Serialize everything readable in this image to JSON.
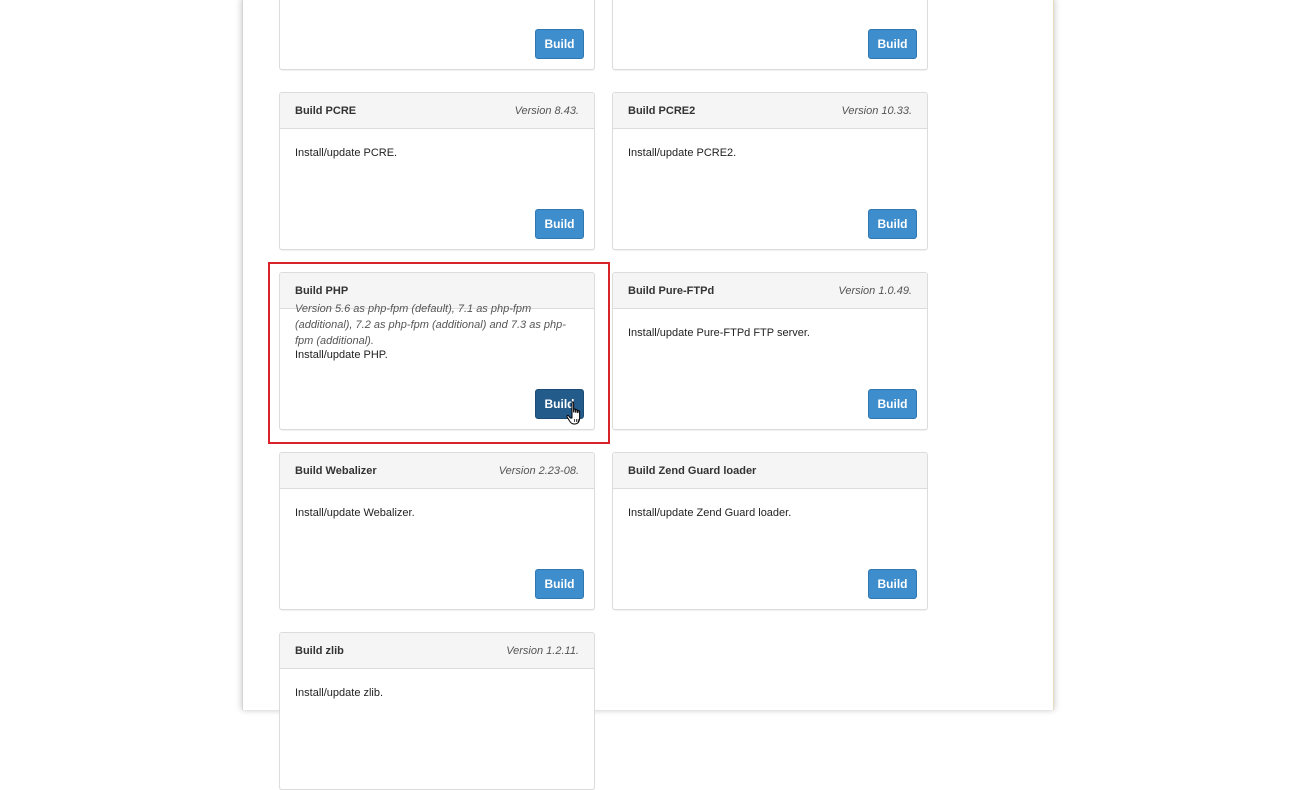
{
  "button_label": "Build",
  "cards": {
    "top_left": {
      "title": "",
      "version": "",
      "desc": ""
    },
    "top_right": {
      "title": "",
      "version": "",
      "desc": ""
    },
    "pcre": {
      "title": "Build PCRE",
      "version": "Version 8.43.",
      "desc": "Install/update PCRE."
    },
    "pcre2": {
      "title": "Build PCRE2",
      "version": "Version 10.33.",
      "desc": "Install/update PCRE2."
    },
    "php": {
      "title": "Build PHP",
      "version": "Version 5.6 as php-fpm (default), 7.1 as php-fpm (additional), 7.2 as php-fpm (additional) and 7.3 as php-fpm (additional).",
      "desc": "Install/update PHP."
    },
    "pureftpd": {
      "title": "Build Pure-FTPd",
      "version": "Version 1.0.49.",
      "desc": "Install/update Pure-FTPd FTP server."
    },
    "webalizer": {
      "title": "Build Webalizer",
      "version": "Version 2.23-08.",
      "desc": "Install/update Webalizer."
    },
    "zend": {
      "title": "Build Zend Guard loader",
      "version": "",
      "desc": "Install/update Zend Guard loader."
    },
    "zlib": {
      "title": "Build zlib",
      "version": "Version 1.2.11.",
      "desc": "Install/update zlib."
    }
  },
  "colors": {
    "button": "#3e8dcc",
    "button_active": "#235b8b",
    "highlight": "#d8232a"
  },
  "icons": {
    "cursor": "hand-pointer-icon"
  }
}
